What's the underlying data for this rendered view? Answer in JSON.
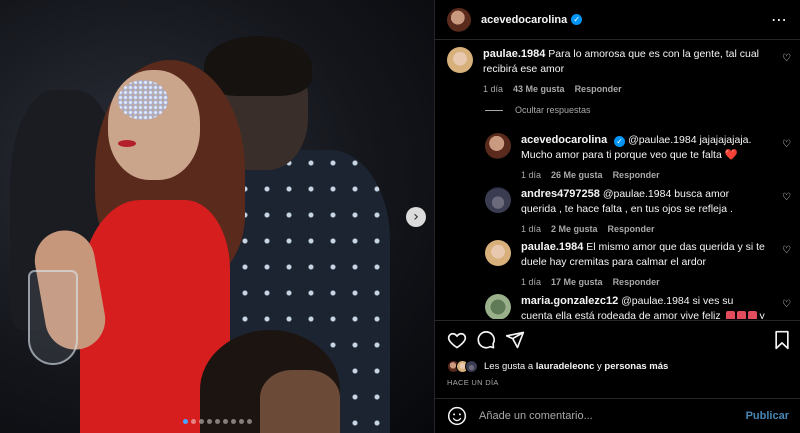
{
  "post": {
    "username": "acevedocarolina",
    "verified": true,
    "more_icon": "more-options-icon",
    "carousel": {
      "current_index": 0,
      "total": 9,
      "next_icon": "chevron-right-icon"
    }
  },
  "comments": [
    {
      "username": "paulae.1984",
      "text": "Para lo amorosa que es con la gente, tal cual recibirá ese amor",
      "time": "1 día",
      "likes": "43 Me gusta",
      "reply": "Responder"
    },
    {
      "username": "acevedocarolina",
      "verified": true,
      "mention": "@paulae.1984",
      "text": "jajajajajaja. Mucho amor para ti porque veo que te falta",
      "emoji": "❤️",
      "time": "1 día",
      "likes": "26 Me gusta",
      "reply": "Responder"
    },
    {
      "username": "andres4797258",
      "mention": "@paulae.1984",
      "text": "busca amor querida , te hace falta , en tus ojos se refleja .",
      "time": "1 día",
      "likes": "2 Me gusta",
      "reply": "Responder"
    },
    {
      "username": "paulae.1984",
      "text": "El mismo amor que das querida y si te duele hay cremitas para calmar el ardor",
      "time": "1 día",
      "likes": "17 Me gusta",
      "reply": "Responder"
    },
    {
      "username": "maria.gonzalezc12",
      "mention": "@paulae.1984",
      "text": "si ves su cuenta ella está rodeada de amor vive feliz",
      "trailing": "y no"
    }
  ],
  "hide_replies": "Ocultar respuestas",
  "likes": {
    "prefix": "Les gusta a",
    "user": "lauradeleonc",
    "connector": "y",
    "others": "personas más"
  },
  "time_ago": "HACE UN DÍA",
  "composer": {
    "placeholder": "Añade un comentario...",
    "post_label": "Publicar",
    "emoji_icon": "emoji-icon"
  },
  "colors": {
    "accent": "#0095f6",
    "like_red": "#ed2b3c",
    "background": "#000000"
  }
}
